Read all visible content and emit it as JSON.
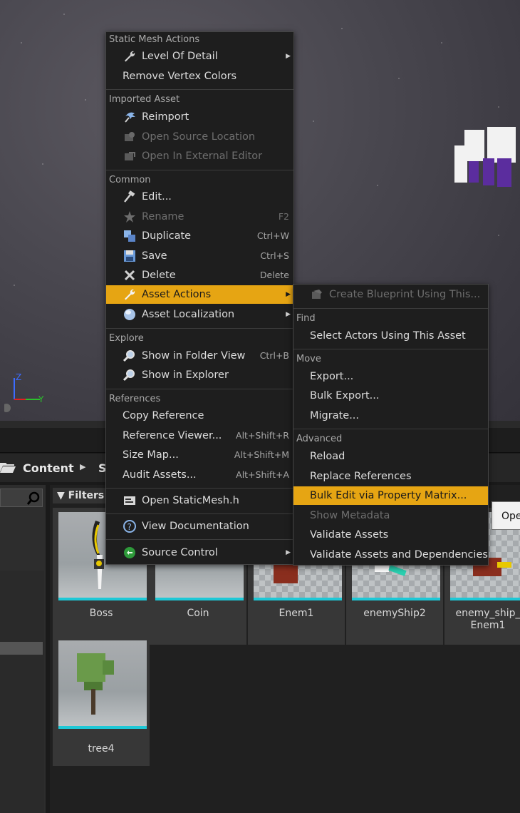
{
  "viewport": {
    "axis": {
      "z_label": "Z",
      "y_label": "Y"
    }
  },
  "content_browser": {
    "breadcrumb": {
      "root": "Content",
      "next": "S"
    },
    "filters_label": "Filters",
    "tooltip_text": "Ope",
    "assets": [
      {
        "name": "Boss"
      },
      {
        "name": "Coin"
      },
      {
        "name": "Enem1"
      },
      {
        "name": "enemyShip2"
      },
      {
        "name": "enemy_ship_\nEnem1"
      },
      {
        "name": "tree4"
      }
    ]
  },
  "menu": {
    "sections": {
      "static_mesh": "Static Mesh Actions",
      "imported": "Imported Asset",
      "common": "Common",
      "explore": "Explore",
      "references": "References"
    },
    "items": {
      "level_of_detail": "Level Of Detail",
      "remove_vertex_colors": "Remove Vertex Colors",
      "reimport": "Reimport",
      "open_source_location": "Open Source Location",
      "open_external_editor": "Open In External Editor",
      "edit": "Edit...",
      "rename": "Rename",
      "rename_sc": "F2",
      "duplicate": "Duplicate",
      "duplicate_sc": "Ctrl+W",
      "save": "Save",
      "save_sc": "Ctrl+S",
      "delete": "Delete",
      "delete_sc": "Delete",
      "asset_actions": "Asset Actions",
      "asset_localization": "Asset Localization",
      "show_in_folder": "Show in Folder View",
      "show_in_folder_sc": "Ctrl+B",
      "show_in_explorer": "Show in Explorer",
      "copy_reference": "Copy Reference",
      "reference_viewer": "Reference Viewer...",
      "reference_viewer_sc": "Alt+Shift+R",
      "size_map": "Size Map...",
      "size_map_sc": "Alt+Shift+M",
      "audit_assets": "Audit Assets...",
      "audit_assets_sc": "Alt+Shift+A",
      "open_header": "Open StaticMesh.h",
      "view_documentation": "View Documentation",
      "source_control": "Source Control"
    }
  },
  "submenu": {
    "sections": {
      "find": "Find",
      "move": "Move",
      "advanced": "Advanced"
    },
    "items": {
      "create_blueprint": "Create Blueprint Using This...",
      "select_actors": "Select Actors Using This Asset",
      "export": "Export...",
      "bulk_export": "Bulk Export...",
      "migrate": "Migrate...",
      "reload": "Reload",
      "replace_references": "Replace References",
      "bulk_edit": "Bulk Edit via Property Matrix...",
      "show_metadata": "Show Metadata",
      "validate_assets": "Validate Assets",
      "validate_assets_deps": "Validate Assets and Dependencies"
    }
  },
  "colors": {
    "highlight": "#e6a513",
    "thumb_bar": "#1ec8d6"
  }
}
